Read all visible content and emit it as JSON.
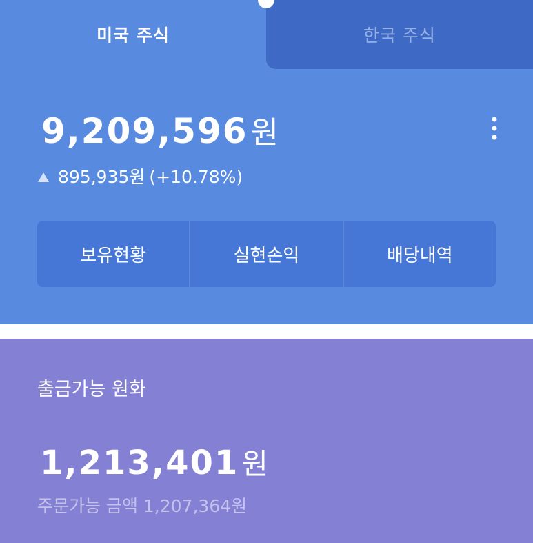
{
  "tabs": {
    "us_label": "미국 주식",
    "kr_label": "한국 주식"
  },
  "portfolio": {
    "total_value": "9,209,596",
    "currency_unit": "원",
    "change_amount": "895,935원",
    "change_percent": "(+10.78%)",
    "change_direction_icon": "up-triangle-icon"
  },
  "actions": [
    {
      "label": "보유현황"
    },
    {
      "label": "실현손익"
    },
    {
      "label": "배당내역"
    }
  ],
  "withdrawable": {
    "label": "출금가능 원화",
    "amount": "1,213,401",
    "currency_unit": "원",
    "orderable_line": "주문가능 금액 1,207,364원"
  },
  "colors": {
    "top_card": "#588adf",
    "inactive_tab": "#3e6ac5",
    "action_button": "#4676d6",
    "bottom_card": "#8480d4"
  }
}
